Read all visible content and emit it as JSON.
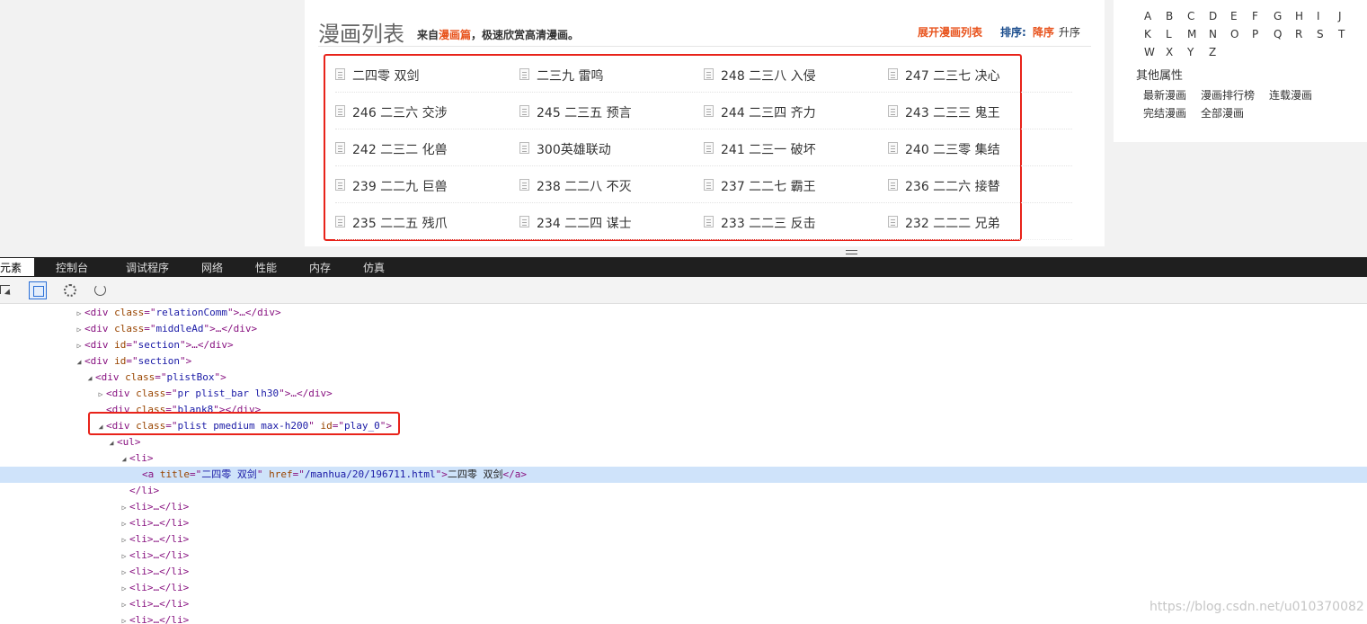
{
  "header": {
    "title": "漫画列表",
    "subtitle_prefix": "来自",
    "subtitle_link": "漫画篇",
    "subtitle_suffix": "，极速欣赏高清漫画。",
    "expand_link": "展开漫画列表",
    "sort_label": "排序:",
    "sort_desc": "降序",
    "sort_asc": "升序"
  },
  "chapters": [
    [
      "二四零 双剑",
      "二三九 雷鸣",
      "248 二三八 入侵",
      "247 二三七 决心"
    ],
    [
      "246 二三六 交涉",
      "245 二三五 预言",
      "244 二三四 齐力",
      "243 二三三 鬼王"
    ],
    [
      "242 二三二 化兽",
      "300英雄联动",
      "241 二三一 破坏",
      "240 二三零 集结"
    ],
    [
      "239 二二九 巨兽",
      "238 二二八 不灭",
      "237 二二七 霸王",
      "236 二二六 接替"
    ],
    [
      "235 二二五 残爪",
      "234 二二四 谋士",
      "233 二二三 反击",
      "232 二二二 兄弟"
    ]
  ],
  "sidebar": {
    "letters_row1": [
      "A",
      "B",
      "C",
      "D",
      "E",
      "F",
      "G",
      "H",
      "I",
      "J"
    ],
    "letters_row2": [
      "K",
      "L",
      "M",
      "N",
      "O",
      "P",
      "Q",
      "R",
      "S",
      "T"
    ],
    "letters_row3": [
      "W",
      "X",
      "Y",
      "Z"
    ],
    "other_heading": "其他属性",
    "links": [
      "最新漫画",
      "漫画排行榜",
      "连载漫画",
      "完结漫画",
      "全部漫画"
    ]
  },
  "devtools": {
    "tabs": [
      "元素",
      "控制台",
      "调试程序",
      "网络",
      "性能",
      "内存",
      "仿真"
    ],
    "active_tab": "元素",
    "dom": [
      {
        "indent": 0,
        "tw": "▷",
        "open": "<div ",
        "attrs": [
          [
            "class",
            "relationComm"
          ]
        ],
        "close": ">…</div>"
      },
      {
        "indent": 0,
        "tw": "▷",
        "open": "<div ",
        "attrs": [
          [
            "class",
            "middleAd"
          ]
        ],
        "close": ">…</div>"
      },
      {
        "indent": 0,
        "tw": "▷",
        "open": "<div ",
        "attrs": [
          [
            "id",
            "section"
          ]
        ],
        "close": ">…</div>"
      },
      {
        "indent": 0,
        "tw": "◢",
        "open": "<div ",
        "attrs": [
          [
            "id",
            "section"
          ]
        ],
        "close": ">"
      },
      {
        "indent": 1,
        "tw": "◢",
        "open": "<div ",
        "attrs": [
          [
            "class",
            "plistBox"
          ]
        ],
        "close": ">"
      },
      {
        "indent": 2,
        "tw": "▷",
        "open": "<div ",
        "attrs": [
          [
            "class",
            "pr plist_bar lh30"
          ]
        ],
        "close": ">…</div>"
      },
      {
        "indent": 2,
        "tw": "",
        "open": "<div ",
        "attrs": [
          [
            "class",
            "blank8"
          ]
        ],
        "close": "></div>"
      },
      {
        "indent": 2,
        "tw": "◢",
        "open": "<div ",
        "attrs": [
          [
            "class",
            "plist pmedium max-h200"
          ],
          [
            "id",
            "play_0"
          ]
        ],
        "close": ">"
      },
      {
        "indent": 3,
        "tw": "◢",
        "open": "<ul",
        "attrs": [],
        "close": ">"
      },
      {
        "indent": 4,
        "tw": "◢",
        "open": "<li",
        "attrs": [],
        "close": ">"
      },
      {
        "indent": 5,
        "tw": "",
        "open": "<a ",
        "attrs": [
          [
            "title",
            "二四零 双剑"
          ],
          [
            "href",
            "/manhua/20/196711.html"
          ]
        ],
        "close": ">",
        "text": "二四零 双剑",
        "end": "</a>",
        "selected": true
      },
      {
        "indent": 4,
        "tw": "",
        "open": "</li>",
        "attrs": [],
        "close": ""
      },
      {
        "indent": 4,
        "tw": "▷",
        "open": "<li>",
        "attrs": [],
        "close": "…</li>"
      },
      {
        "indent": 4,
        "tw": "▷",
        "open": "<li>",
        "attrs": [],
        "close": "…</li>"
      },
      {
        "indent": 4,
        "tw": "▷",
        "open": "<li>",
        "attrs": [],
        "close": "…</li>"
      },
      {
        "indent": 4,
        "tw": "▷",
        "open": "<li>",
        "attrs": [],
        "close": "…</li>"
      },
      {
        "indent": 4,
        "tw": "▷",
        "open": "<li>",
        "attrs": [],
        "close": "…</li>"
      },
      {
        "indent": 4,
        "tw": "▷",
        "open": "<li>",
        "attrs": [],
        "close": "…</li>"
      },
      {
        "indent": 4,
        "tw": "▷",
        "open": "<li>",
        "attrs": [],
        "close": "…</li>"
      },
      {
        "indent": 4,
        "tw": "▷",
        "open": "<li>",
        "attrs": [],
        "close": "…</li>"
      }
    ]
  },
  "watermark": "https://blog.csdn.net/u010370082"
}
